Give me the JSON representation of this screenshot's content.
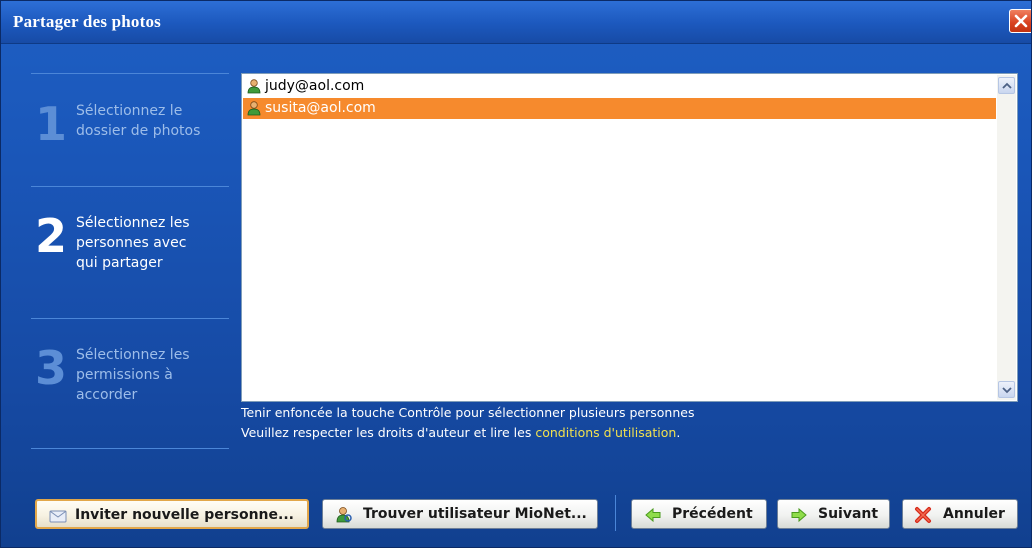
{
  "window": {
    "title": "Partager des photos"
  },
  "steps": [
    {
      "number": "1",
      "text_lines": [
        "Sélectionnez le",
        "dossier de photos"
      ],
      "state": "dim"
    },
    {
      "number": "2",
      "text_lines": [
        "Sélectionnez les",
        "personnes avec",
        "qui partager"
      ],
      "state": "active"
    },
    {
      "number": "3",
      "text_lines": [
        "Sélectionnez les",
        "permissions à",
        "accorder"
      ],
      "state": "dim"
    }
  ],
  "contacts": [
    {
      "email": "judy@aol.com",
      "selected": false,
      "icon": "user-icon"
    },
    {
      "email": "susita@aol.com",
      "selected": true,
      "icon": "user-icon"
    }
  ],
  "hints": {
    "line1": "Tenir enfoncée la touche Contrôle pour sélectionner plusieurs personnes",
    "line2_prefix": "Veuillez respecter les droits d'auteur et lire les ",
    "line2_link": "conditions d'utilisation",
    "line2_suffix": "."
  },
  "buttons": {
    "invite": {
      "label": "Inviter nouvelle personne...",
      "icon": "envelope-icon"
    },
    "find": {
      "label": "Trouver utilisateur MioNet...",
      "icon": "user-search-icon"
    },
    "previous": {
      "label": "Précédent",
      "icon": "arrow-left-icon"
    },
    "next": {
      "label": "Suivant",
      "icon": "arrow-right-icon"
    },
    "cancel": {
      "label": "Annuler",
      "icon": "red-x-icon"
    }
  },
  "colors": {
    "background": "#1a56b8",
    "selection": "#f68a2d",
    "link": "#f0e050",
    "close_button": "#d8401f"
  }
}
